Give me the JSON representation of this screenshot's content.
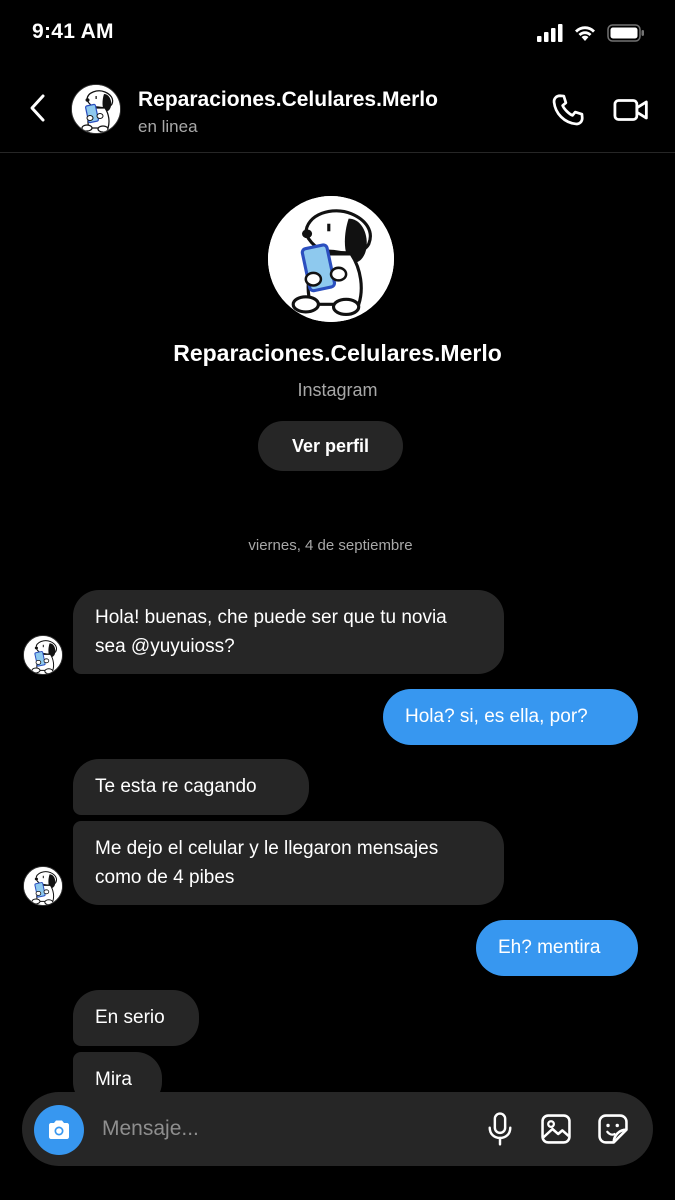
{
  "status": {
    "time": "9:41 AM"
  },
  "header": {
    "name": "Reparaciones.Celulares.Merlo",
    "subtitle": "en linea"
  },
  "profile": {
    "name": "Reparaciones.Celulares.Merlo",
    "platform": "Instagram",
    "view_profile_label": "Ver perfil"
  },
  "date_separator": "viernes, 4 de septiembre",
  "messages": [
    {
      "from": "them",
      "text": "Hola! buenas, che puede ser que tu novia sea @yuyuioss?"
    },
    {
      "from": "me",
      "text": "Hola? si, es ella, por?"
    },
    {
      "from": "them",
      "text": "Te esta re cagando"
    },
    {
      "from": "them",
      "text": "Me dejo el celular y le llegaron mensajes como de 4 pibes"
    },
    {
      "from": "me",
      "text": "Eh? mentira"
    },
    {
      "from": "them",
      "text": "En serio"
    },
    {
      "from": "them",
      "text": "Mira"
    }
  ],
  "composer": {
    "placeholder": "Mensaje..."
  },
  "colors": {
    "accent": "#3797f0",
    "incoming_bubble": "#262626",
    "background": "#000000"
  },
  "icons": [
    "back-icon",
    "phone-icon",
    "video-camera-icon",
    "camera-icon",
    "microphone-icon",
    "gallery-icon",
    "sticker-icon"
  ]
}
